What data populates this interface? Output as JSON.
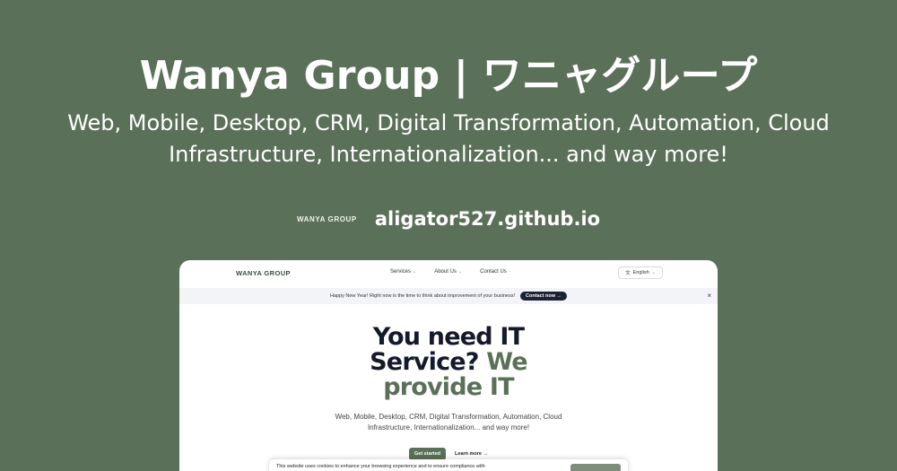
{
  "card": {
    "title": "Wanya Group | ワニャグループ",
    "description": "Web, Mobile, Desktop, CRM, Digital Transformation, Automation, Cloud Infrastructure, Internationalization... and way more!",
    "logo_text": "WANYA GROUP",
    "domain": "aligator527.github.io"
  },
  "site": {
    "logo": "WANYA GROUP",
    "nav": [
      {
        "label": "Services",
        "icon": "chevron-down-icon"
      },
      {
        "label": "About Us",
        "icon": "chevron-down-icon"
      },
      {
        "label": "Contact Us"
      }
    ],
    "language": {
      "icon": "translate-icon",
      "label": "English",
      "chevron": "chevron-down-icon"
    },
    "announcement": {
      "text": "Happy New Year! Right now is the time to think about improvement of your business!",
      "cta": "Contact now →",
      "close": "×"
    },
    "hero": {
      "title_line1": "You need IT",
      "title_line2a": "Service?",
      "title_line2b": "We",
      "title_line3": "provide IT",
      "description": "Web, Mobile, Desktop, CRM, Digital Transformation, Automation, Cloud Infrastructure, Internationalization... and way more!",
      "primary_button": "Get started",
      "secondary_link": "Learn more →"
    },
    "cookie": {
      "text": "This website uses cookies to enhance your browsing experience and to ensure compliance with"
    }
  },
  "colors": {
    "background": "#5b7058",
    "accent": "#5b7058",
    "dark": "#1c2333"
  }
}
